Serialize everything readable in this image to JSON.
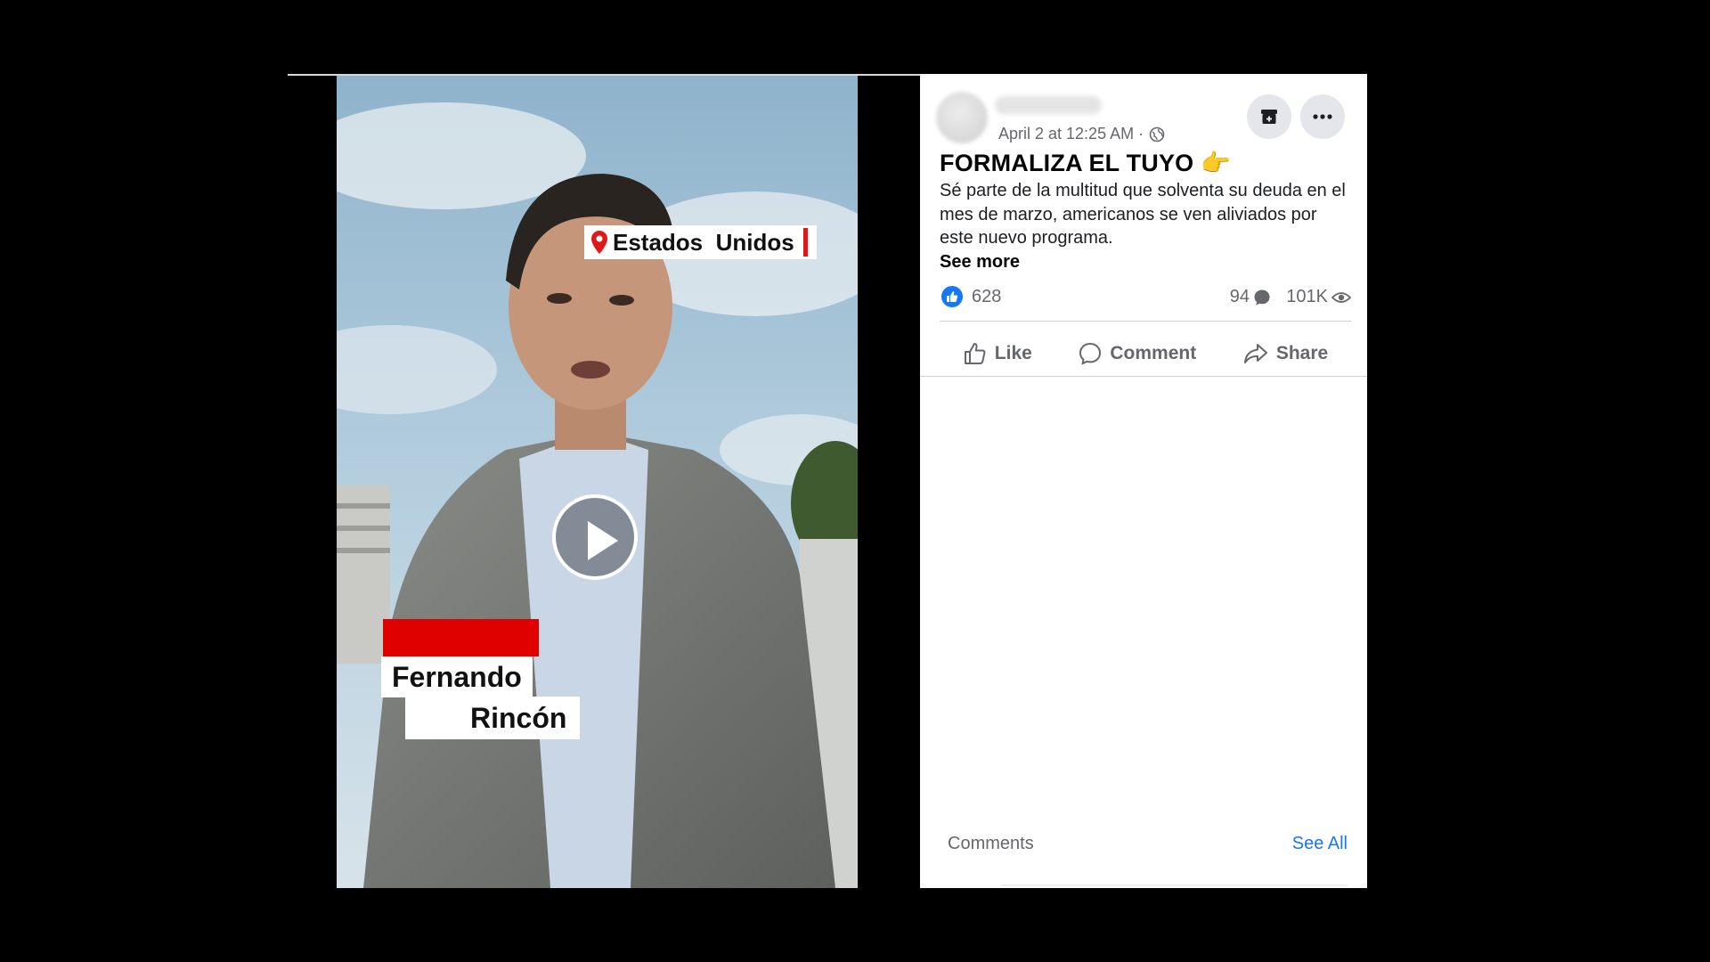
{
  "video": {
    "location_tag": "Estados  Unidos",
    "name_first": "Fernando",
    "name_last": "Rincón"
  },
  "post": {
    "timestamp": "April 2 at 12:25 AM ·",
    "title": "FORMALIZA EL TUYO 👉",
    "body": "Sé parte de la multitud que solventa su deuda en el mes de marzo, americanos se ven aliviados por este nuevo programa.",
    "see_more": "See more"
  },
  "stats": {
    "likes": "628",
    "comments": "94",
    "views": "101K"
  },
  "actions": {
    "like": "Like",
    "comment": "Comment",
    "share": "Share"
  },
  "comments_section": {
    "label": "Comments",
    "see_all": "See All"
  },
  "colors": {
    "accent": "#1877f2",
    "tag_red": "#e00000",
    "muted_text": "#65676b"
  }
}
